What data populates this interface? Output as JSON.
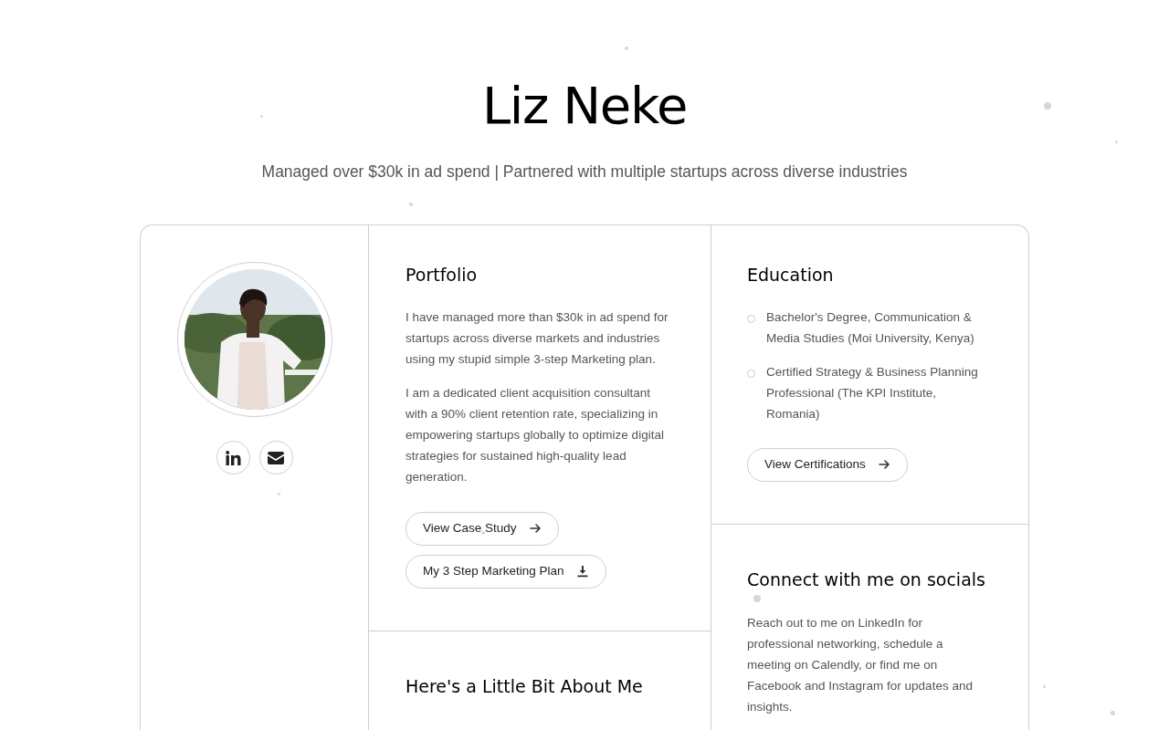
{
  "header": {
    "name": "Liz Neke",
    "tagline": "Managed over $30k in ad spend | Partnered with multiple startups across diverse industries"
  },
  "profile": {
    "socials": [
      {
        "kind": "linkedin"
      },
      {
        "kind": "email"
      }
    ]
  },
  "portfolio": {
    "title": "Portfolio",
    "paragraphs": [
      "I have managed more than $30k in ad spend for startups across diverse markets and industries using my stupid simple 3-step Marketing plan.",
      "I am a dedicated client acquisition consultant with a 90% client retention rate, specializing in empowering startups globally to optimize digital strategies for sustained high-quality lead generation."
    ],
    "buttons": [
      {
        "label": "View Case Study",
        "kind": "link"
      },
      {
        "label": "My 3 Step Marketing Plan",
        "kind": "download"
      }
    ]
  },
  "about": {
    "title": "Here's a Little Bit About Me"
  },
  "education": {
    "title": "Education",
    "items": [
      "Bachelor's Degree, Communication & Media Studies (Moi University, Kenya)",
      "Certified Strategy & Business Planning Professional (The KPI Institute, Romania)"
    ],
    "button": {
      "label": "View Certifications",
      "kind": "link"
    }
  },
  "socials_section": {
    "title": "Connect with me on socials",
    "text": "Reach out to me on LinkedIn for professional networking, schedule a meeting on Calendly, or find me on Facebook and Instagram for updates and insights."
  }
}
